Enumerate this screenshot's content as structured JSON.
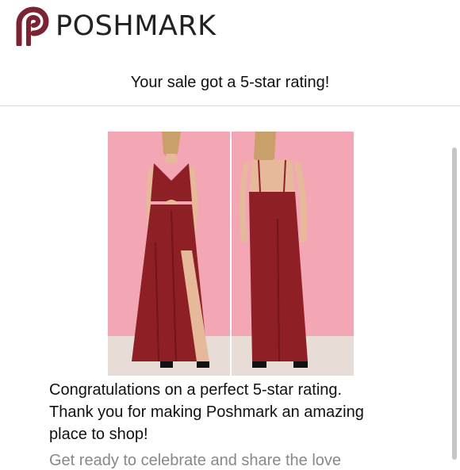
{
  "header": {
    "brand": "POSHMARK",
    "logo_icon": "poshmark-logo-icon"
  },
  "email": {
    "subject_line": "Your sale got a 5-star rating!",
    "message_line1": "Congratulations on a perfect 5-star rating.",
    "message_line2": "Thank you for making Poshmark an amazing",
    "message_line3": "place to shop!",
    "cutoff_text": "Get ready to celebrate and share the love"
  },
  "product": {
    "photos": [
      "jumpsuit-front-photo",
      "jumpsuit-back-photo"
    ],
    "colors": {
      "background_pink": "#f3a6b4",
      "garment_red": "#8e1f24",
      "floor": "#e8ddd6"
    }
  },
  "colors": {
    "brand": "#7b2332",
    "text": "#111111",
    "divider": "#d6d6d6"
  }
}
